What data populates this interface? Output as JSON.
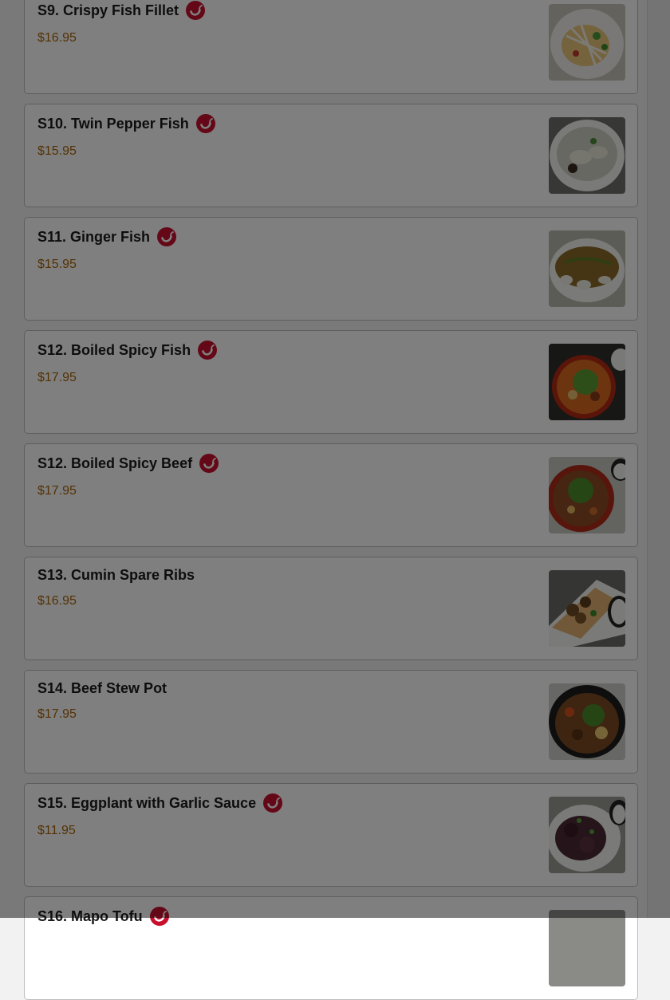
{
  "menu": {
    "items": [
      {
        "name": "S9. Crispy Fish Fillet",
        "price": "$16.95",
        "spicy": true,
        "icon": "chili-pepper-icon",
        "photo": "crispy-fish-fillet-photo"
      },
      {
        "name": "S10. Twin Pepper Fish",
        "price": "$15.95",
        "spicy": true,
        "icon": "chili-pepper-icon",
        "photo": "twin-pepper-fish-photo"
      },
      {
        "name": "S11. Ginger Fish",
        "price": "$15.95",
        "spicy": true,
        "icon": "chili-pepper-icon",
        "photo": "ginger-fish-photo"
      },
      {
        "name": "S12. Boiled Spicy Fish",
        "price": "$17.95",
        "spicy": true,
        "icon": "chili-pepper-icon",
        "photo": "boiled-spicy-fish-photo"
      },
      {
        "name": "S12. Boiled Spicy Beef",
        "price": "$17.95",
        "spicy": true,
        "icon": "chili-pepper-icon",
        "photo": "boiled-spicy-beef-photo"
      },
      {
        "name": "S13. Cumin Spare Ribs",
        "price": "$16.95",
        "spicy": false,
        "photo": "cumin-spare-ribs-photo"
      },
      {
        "name": "S14. Beef Stew Pot",
        "price": "$17.95",
        "spicy": false,
        "photo": "beef-stew-pot-photo"
      },
      {
        "name": "S15. Eggplant with Garlic Sauce",
        "price": "$11.95",
        "spicy": true,
        "icon": "chili-pepper-icon",
        "photo": "eggplant-garlic-sauce-photo"
      },
      {
        "name": "S16. Mapo Tofu",
        "price": "",
        "spicy": true,
        "icon": "chili-pepper-icon",
        "photo": "mapo-tofu-photo"
      }
    ]
  },
  "colors": {
    "price": "#a8650a",
    "spicy_badge": "#c8102e",
    "overlay": "rgba(0,0,0,0.5)"
  }
}
